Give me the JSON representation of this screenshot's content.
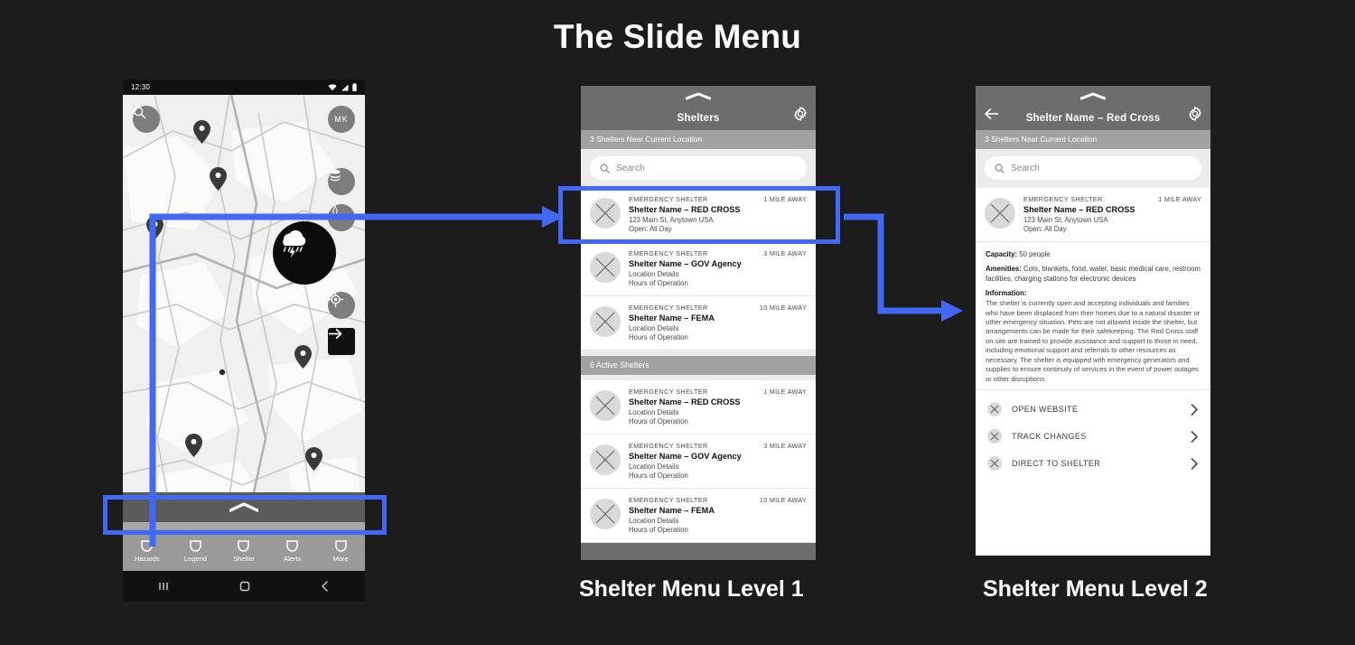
{
  "page": {
    "title": "The Slide Menu",
    "accent_blue": "#4169F5",
    "background": "#1C1C1C"
  },
  "phone": {
    "status_bar": {
      "time": "12:30",
      "icons": [
        "wifi-icon",
        "signal-icon",
        "battery-icon"
      ]
    },
    "map": {
      "search_icon": "search-icon",
      "avatar_initials": "MK",
      "controls": [
        "layers-icon",
        "compass-icon",
        "locate-icon",
        "arrow-right-icon"
      ],
      "weather_badge_icon": "thunderstorm-icon",
      "pin_icon": "map-pin-icon"
    },
    "slide_handle": "chevron-up-icon",
    "tabbar": [
      {
        "label": "Hazards",
        "icon": "hazards-icon"
      },
      {
        "label": "Legend",
        "icon": "legend-icon"
      },
      {
        "label": "Shelter",
        "icon": "shelter-icon"
      },
      {
        "label": "Alerts",
        "icon": "alerts-icon"
      },
      {
        "label": "More",
        "icon": "more-icon"
      }
    ],
    "navbar": [
      "recents-icon",
      "home-icon",
      "back-icon"
    ]
  },
  "level1": {
    "caption": "Shelter Menu Level 1",
    "header": {
      "title": "Shelters",
      "grabber": "chevron-up-icon",
      "gear": "gear-icon"
    },
    "subbar": "3 Shelters Near Current Location",
    "search": {
      "placeholder": "Search",
      "icon": "search-icon"
    },
    "near_list": [
      {
        "kicker": "EMERGENCY SHELTER",
        "distance": "1 MILE AWAY",
        "name": "Shelter Name – RED CROSS",
        "line1": "123 Main St, Anytown USA",
        "line2": "Open: All Day",
        "highlighted": true
      },
      {
        "kicker": "EMERGENCY SHELTER",
        "distance": "3 MILE AWAY",
        "name": "Shelter Name – GOV Agency",
        "line1": "Location Details",
        "line2": "Hours of Operation",
        "highlighted": false
      },
      {
        "kicker": "EMERGENCY SHELTER",
        "distance": "10 MILE AWAY",
        "name": "Shelter Name – FEMA",
        "line1": "Location Details",
        "line2": "Hours of Operation",
        "highlighted": false
      }
    ],
    "section_head": "6 Active Shelters",
    "active_list": [
      {
        "kicker": "EMERGENCY SHELTER",
        "distance": "1 MILE AWAY",
        "name": "Shelter Name – RED CROSS",
        "line1": "Location Details",
        "line2": "Hours of Operation"
      },
      {
        "kicker": "EMERGENCY SHELTER",
        "distance": "3 MILE AWAY",
        "name": "Shelter Name – GOV Agency",
        "line1": "Location Details",
        "line2": "Hours of Operation"
      },
      {
        "kicker": "EMERGENCY SHELTER",
        "distance": "10 MILE AWAY",
        "name": "Shelter Name – FEMA",
        "line1": "Location Details",
        "line2": "Hours of Operation"
      }
    ]
  },
  "level2": {
    "caption": "Shelter Menu Level 2",
    "header": {
      "title": "Shelter Name – Red Cross",
      "grabber": "chevron-up-icon",
      "gear": "gear-icon",
      "back": "arrow-left-icon"
    },
    "subbar": "3 Shelters Near Current Location",
    "search": {
      "placeholder": "Search",
      "icon": "search-icon"
    },
    "summary": {
      "kicker": "EMERGENCY SHELTER",
      "distance": "1 MILE AWAY",
      "name": "Shelter Name – RED CROSS",
      "line1": "123 Main St, Anytown USA",
      "line2": "Open: All Day"
    },
    "capacity_label": "Capacity:",
    "capacity_value": " 50 people",
    "amenities_label": "Amenities:",
    "amenities_value": " Cots, blankets, food, water, basic medical care, restroom facilities, charging stations for electronic devices",
    "information_label": "Information:",
    "information_body": "The shelter is currently open and accepting individuals and families who have been displaced from their homes due to a natural disaster or other emergency situation. Pets are not allowed inside the shelter, but arrangements can be made for their safekeeping. The Red Cross staff on site are trained to provide assistance and support to those in need, including emotional support and referrals to other resources as necessary. The shelter is equipped with emergency generators and supplies to ensure continuity of services in the event of power outages or other disruptions.",
    "actions": [
      {
        "label": "OPEN WEBSITE",
        "icon": "placeholder-x-icon",
        "chevron": "chevron-right-icon"
      },
      {
        "label": "TRACK CHANGES",
        "icon": "placeholder-x-icon",
        "chevron": "chevron-right-icon"
      },
      {
        "label": "DIRECT TO SHELTER",
        "icon": "placeholder-x-icon",
        "chevron": "chevron-right-icon"
      }
    ]
  }
}
